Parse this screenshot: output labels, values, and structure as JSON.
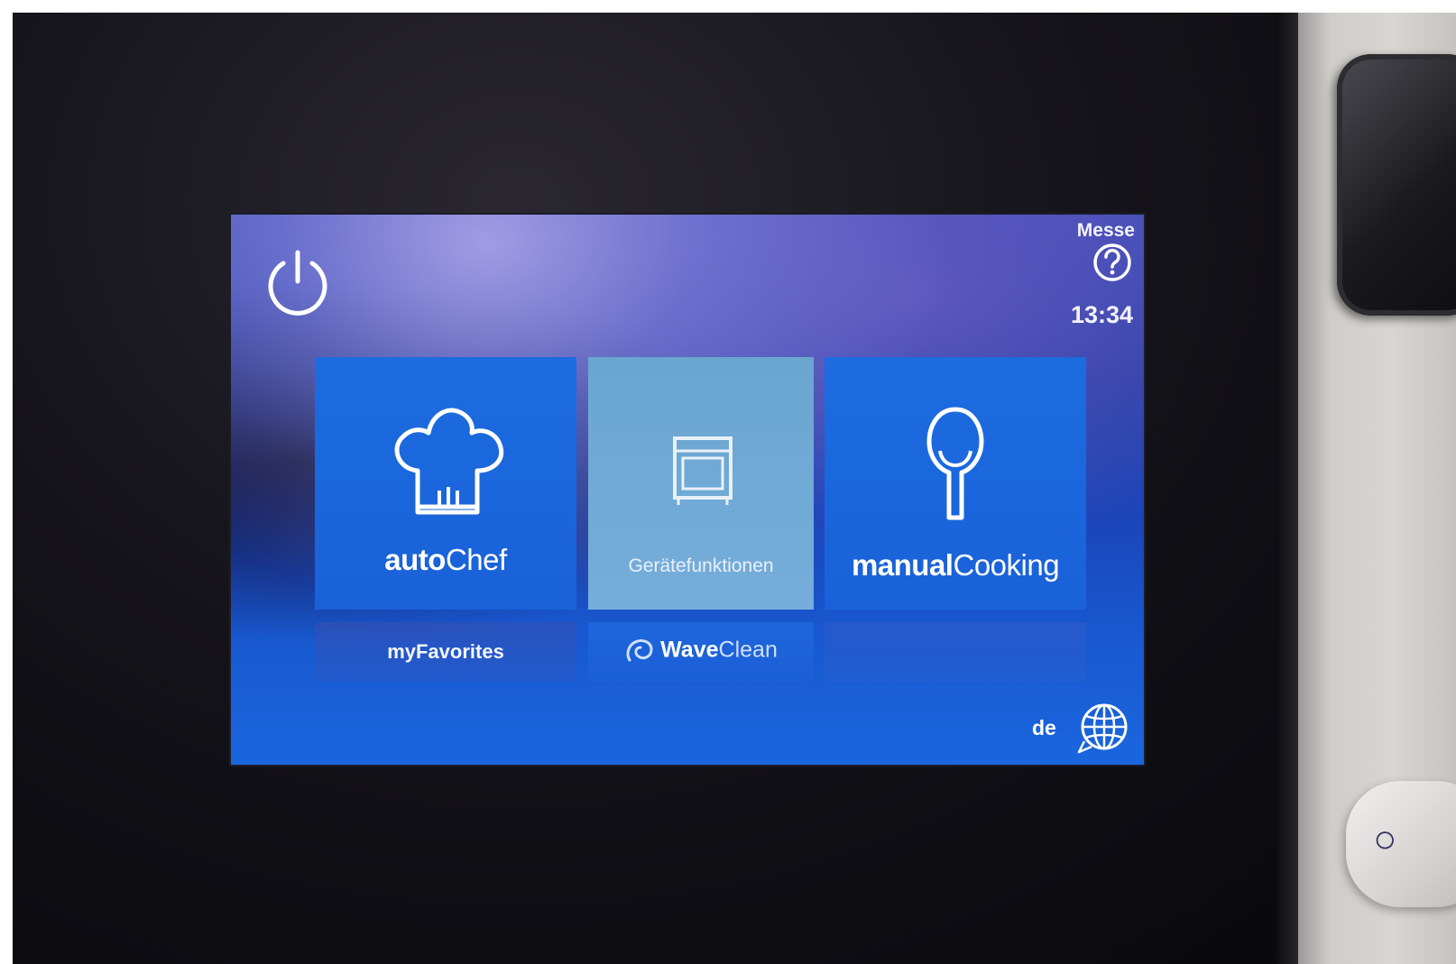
{
  "header": {
    "power_icon": "power-icon",
    "mode_label": "Messe",
    "help_icon": "help-icon",
    "clock": "13:34"
  },
  "tiles": [
    {
      "icon": "chef-hat-icon",
      "label_bold": "auto",
      "label_thin": "Chef",
      "color": "#1a64dc"
    },
    {
      "icon": "oven-icon",
      "label": "Gerätefunktionen",
      "color": "#72aad6"
    },
    {
      "icon": "spoon-icon",
      "label_bold": "manual",
      "label_thin": "Cooking",
      "color": "#1a64dc"
    }
  ],
  "sub_tiles": [
    {
      "label": "myFavorites"
    },
    {
      "icon": "wave-swirl-icon",
      "label_bold": "Wave",
      "label_thin": "Clean"
    },
    {
      "label": ""
    }
  ],
  "footer": {
    "language": "de",
    "language_icon": "globe-icon"
  },
  "colors": {
    "screen_blue": "#1a5fd6",
    "tile_blue": "#1a64dc",
    "tile_grey": "#72aad6"
  }
}
